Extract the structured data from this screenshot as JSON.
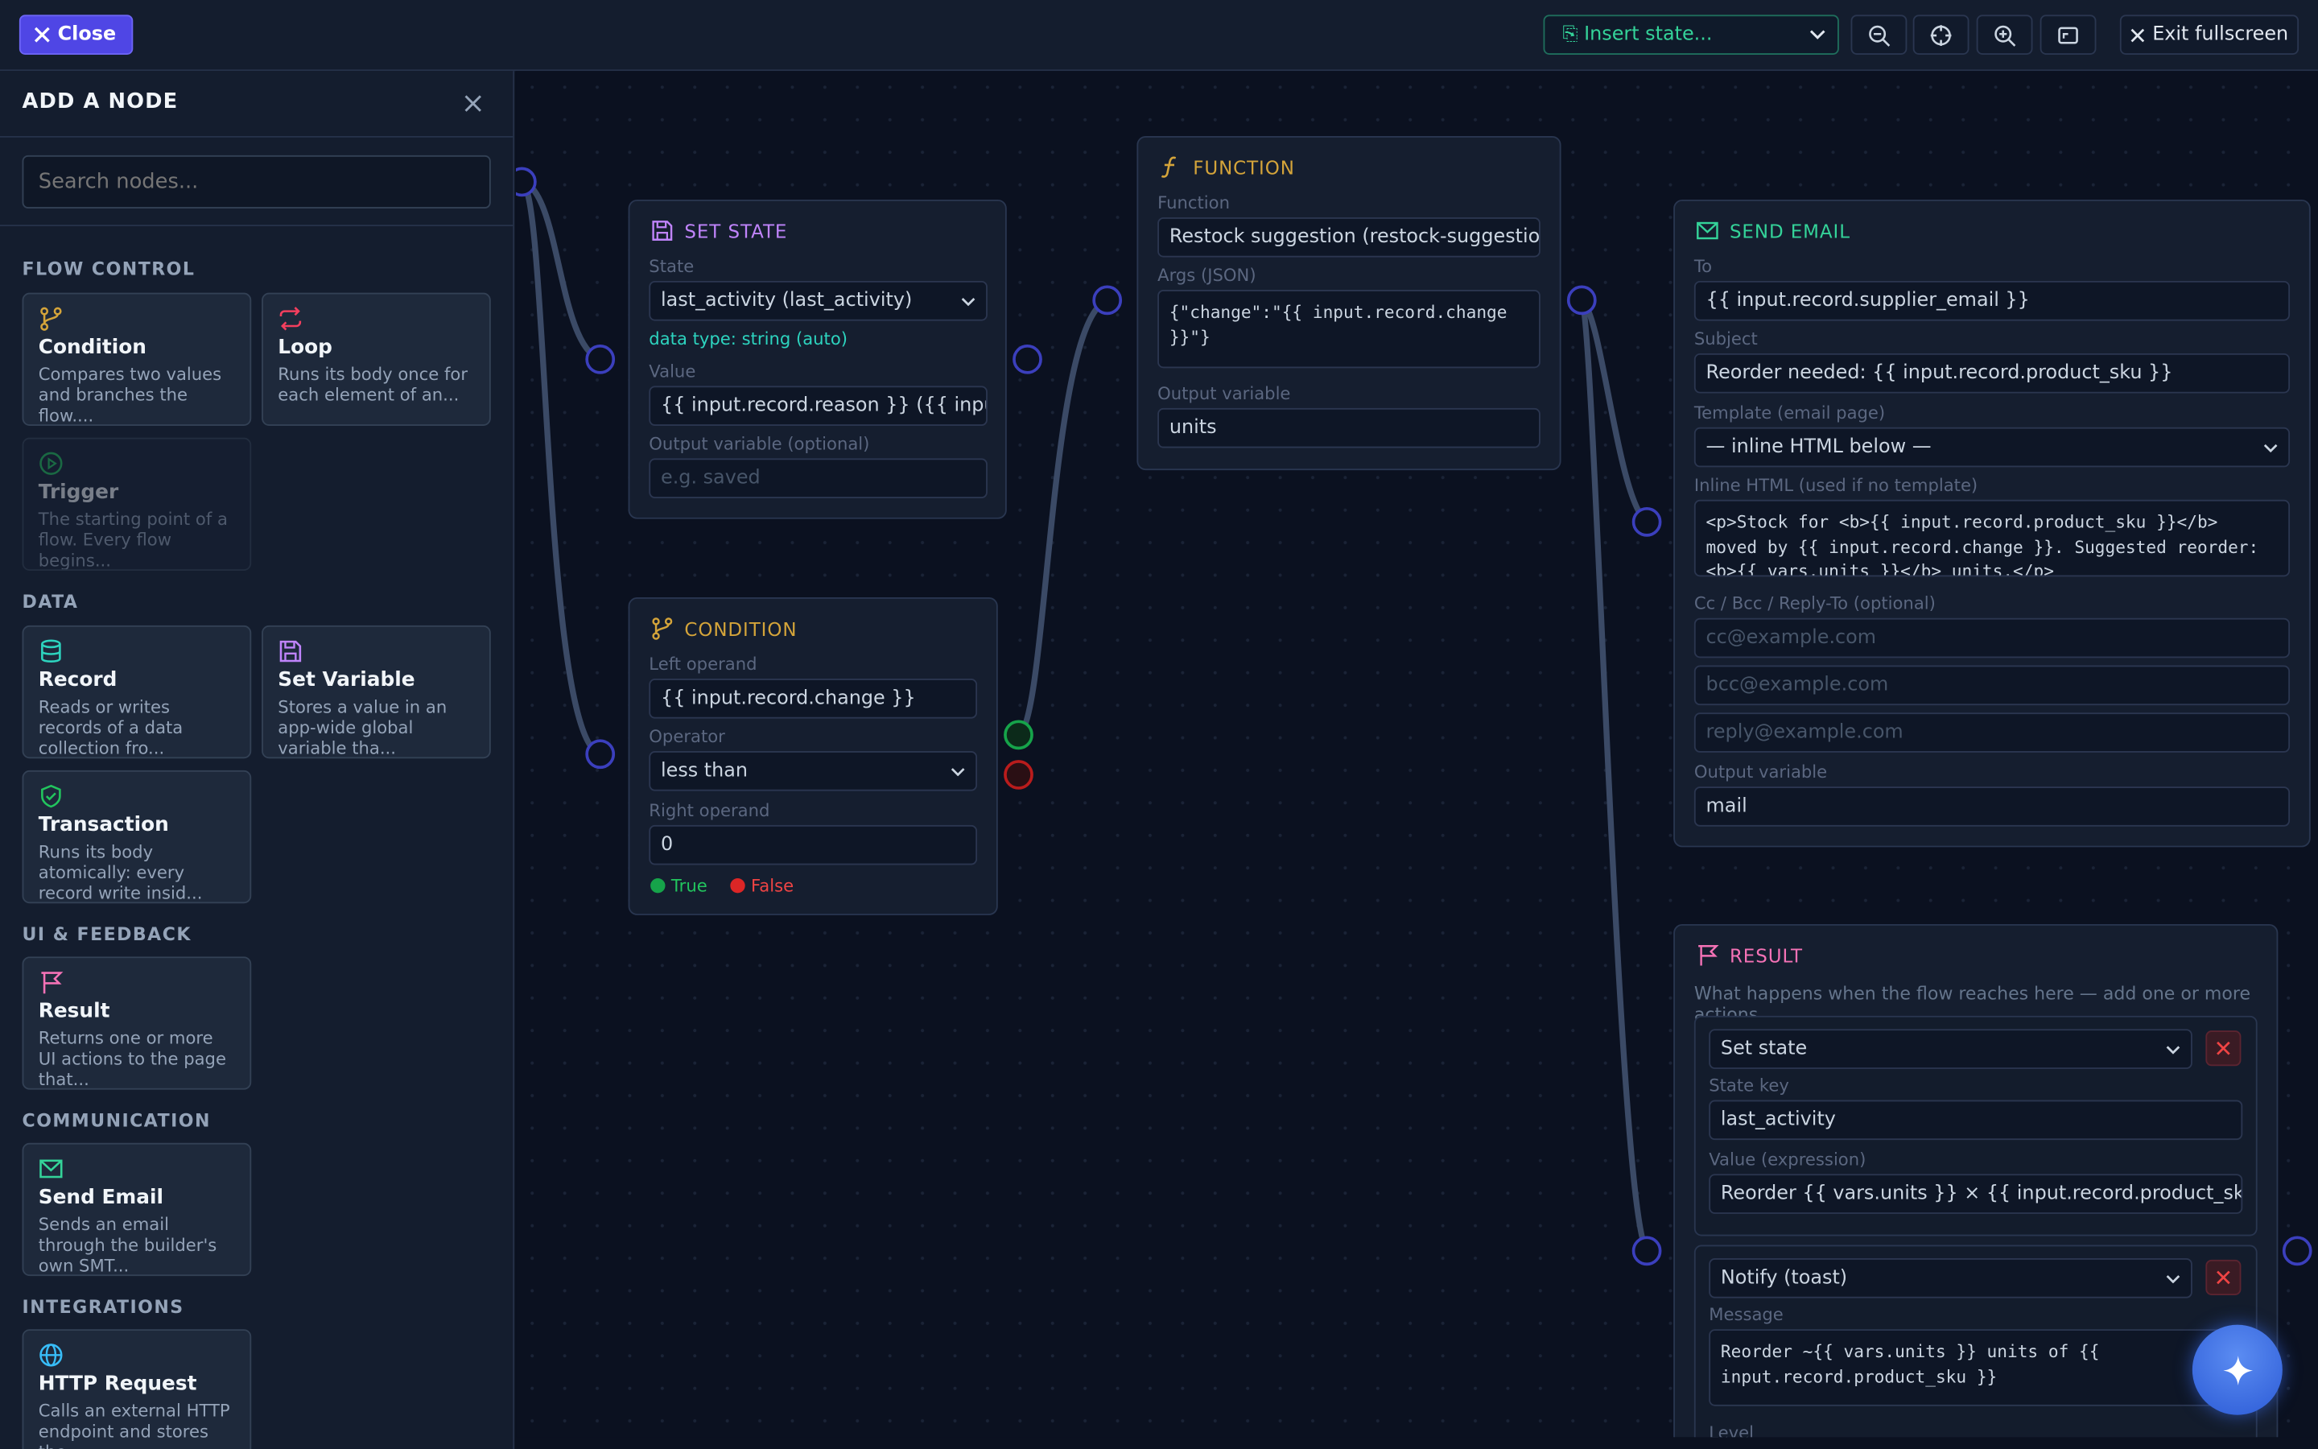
{
  "topbar": {
    "close_label": "Close",
    "insert_state_label": "⎘ Insert state...",
    "exit_fullscreen_label": "Exit fullscreen"
  },
  "sidebar": {
    "title": "ADD A NODE",
    "search_placeholder": "Search nodes...",
    "sections": {
      "flow_control": "FLOW CONTROL",
      "data": "DATA",
      "ui_feedback": "UI & FEEDBACK",
      "communication": "COMMUNICATION",
      "integrations": "INTEGRATIONS"
    },
    "cards": {
      "condition": {
        "title": "Condition",
        "desc": "Compares two values and branches the flow...."
      },
      "loop": {
        "title": "Loop",
        "desc": "Runs its body once for each element of an..."
      },
      "trigger": {
        "title": "Trigger",
        "desc": "The starting point of a flow. Every flow begins..."
      },
      "record": {
        "title": "Record",
        "desc": "Reads or writes records of a data collection fro..."
      },
      "set_variable": {
        "title": "Set Variable",
        "desc": "Stores a value in an app-wide global variable tha..."
      },
      "transaction": {
        "title": "Transaction",
        "desc": "Runs its body atomically: every record write insid..."
      },
      "result": {
        "title": "Result",
        "desc": "Returns one or more UI actions to the page that..."
      },
      "send_email": {
        "title": "Send Email",
        "desc": "Sends an email through the builder's own SMT..."
      },
      "http_request": {
        "title": "HTTP Request",
        "desc": "Calls an external HTTP endpoint and stores the..."
      }
    }
  },
  "nodes": {
    "set_state": {
      "title": "SET STATE",
      "state_label": "State",
      "state_value": "last_activity (last_activity)",
      "data_type": "data type: string (auto)",
      "value_label": "Value",
      "value": "{{ input.record.reason }} ({{ input.record",
      "output_label": "Output variable (optional)",
      "output_placeholder": "e.g. saved"
    },
    "condition": {
      "title": "CONDITION",
      "left_label": "Left operand",
      "left_value": "{{ input.record.change }}",
      "operator_label": "Operator",
      "operator_value": "less than",
      "right_label": "Right operand",
      "right_value": "0",
      "true_label": "True",
      "false_label": "False"
    },
    "function": {
      "title": "FUNCTION",
      "function_label": "Function",
      "function_value": "Restock suggestion (restock-suggestion)",
      "args_label": "Args (JSON)",
      "args_value": "{\"change\":\"{{ input.record.change }}\"}",
      "output_label": "Output variable",
      "output_value": "units"
    },
    "send_email": {
      "title": "SEND EMAIL",
      "to_label": "To",
      "to_value": "{{ input.record.supplier_email }}",
      "subject_label": "Subject",
      "subject_value": "Reorder needed: {{ input.record.product_sku }}",
      "template_label": "Template (email page)",
      "template_value": "— inline HTML below —",
      "html_label": "Inline HTML (used if no template)",
      "html_value": "<p>Stock for <b>{{ input.record.product_sku }}</b> moved by {{ input.record.change }}. Suggested reorder: <b>{{ vars.units }}</b> units.</p>",
      "cc_label": "Cc / Bcc / Reply-To (optional)",
      "cc_placeholder": "cc@example.com",
      "bcc_placeholder": "bcc@example.com",
      "reply_placeholder": "reply@example.com",
      "output_label": "Output variable",
      "output_value": "mail"
    },
    "result": {
      "title": "RESULT",
      "description": "What happens when the flow reaches here — add one or more actions.",
      "action1_type": "Set state",
      "state_key_label": "State key",
      "state_key_value": "last_activity",
      "value_expr_label": "Value (expression)",
      "value_expr_value": "Reorder {{ vars.units }} × {{ input.record.product_sku }}",
      "action2_type": "Notify (toast)",
      "message_label": "Message",
      "message_value": "Reorder ~{{ vars.units }} units of {{ input.record.product_sku }}",
      "level_label": "Level"
    }
  },
  "colors": {
    "accent": "#4f46e5",
    "set_state": "#c084fc",
    "condition": "#d4a43a",
    "function": "#d4a43a",
    "send_email": "#34d399",
    "result": "#f472b6",
    "true": "#22c55e",
    "false": "#ef4444"
  }
}
